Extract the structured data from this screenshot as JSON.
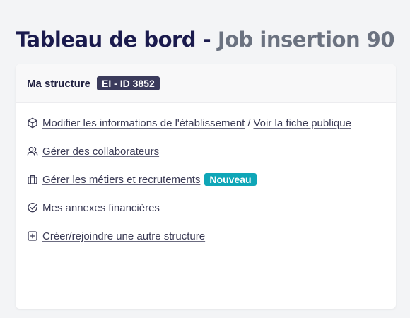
{
  "page": {
    "title_main": "Tableau de bord",
    "title_sep": "-",
    "title_structure": "Job insertion 90"
  },
  "card": {
    "header_label": "Ma structure",
    "structure_badge": "EI - ID 3852",
    "rows": [
      {
        "icon": "cube-icon",
        "links": [
          "Modifier les informations de l'établissement",
          "Voir la fiche publique"
        ],
        "separator": "/"
      },
      {
        "icon": "users-icon",
        "links": [
          "Gérer des collaborateurs"
        ]
      },
      {
        "icon": "briefcase-icon",
        "links": [
          "Gérer les métiers et recrutements"
        ],
        "badge": "Nouveau"
      },
      {
        "icon": "check-circle-icon",
        "links": [
          "Mes annexes financières"
        ]
      },
      {
        "icon": "plus-square-icon",
        "links": [
          "Créer/rejoindre une autre structure"
        ]
      }
    ]
  },
  "colors": {
    "page_bg": "#f3f4f6",
    "title_dark": "#1a1a4d",
    "title_muted": "#6b7280",
    "badge_id_bg": "#3b3b5c",
    "badge_new_bg": "#0fa6b7",
    "text": "#3b3b55"
  }
}
